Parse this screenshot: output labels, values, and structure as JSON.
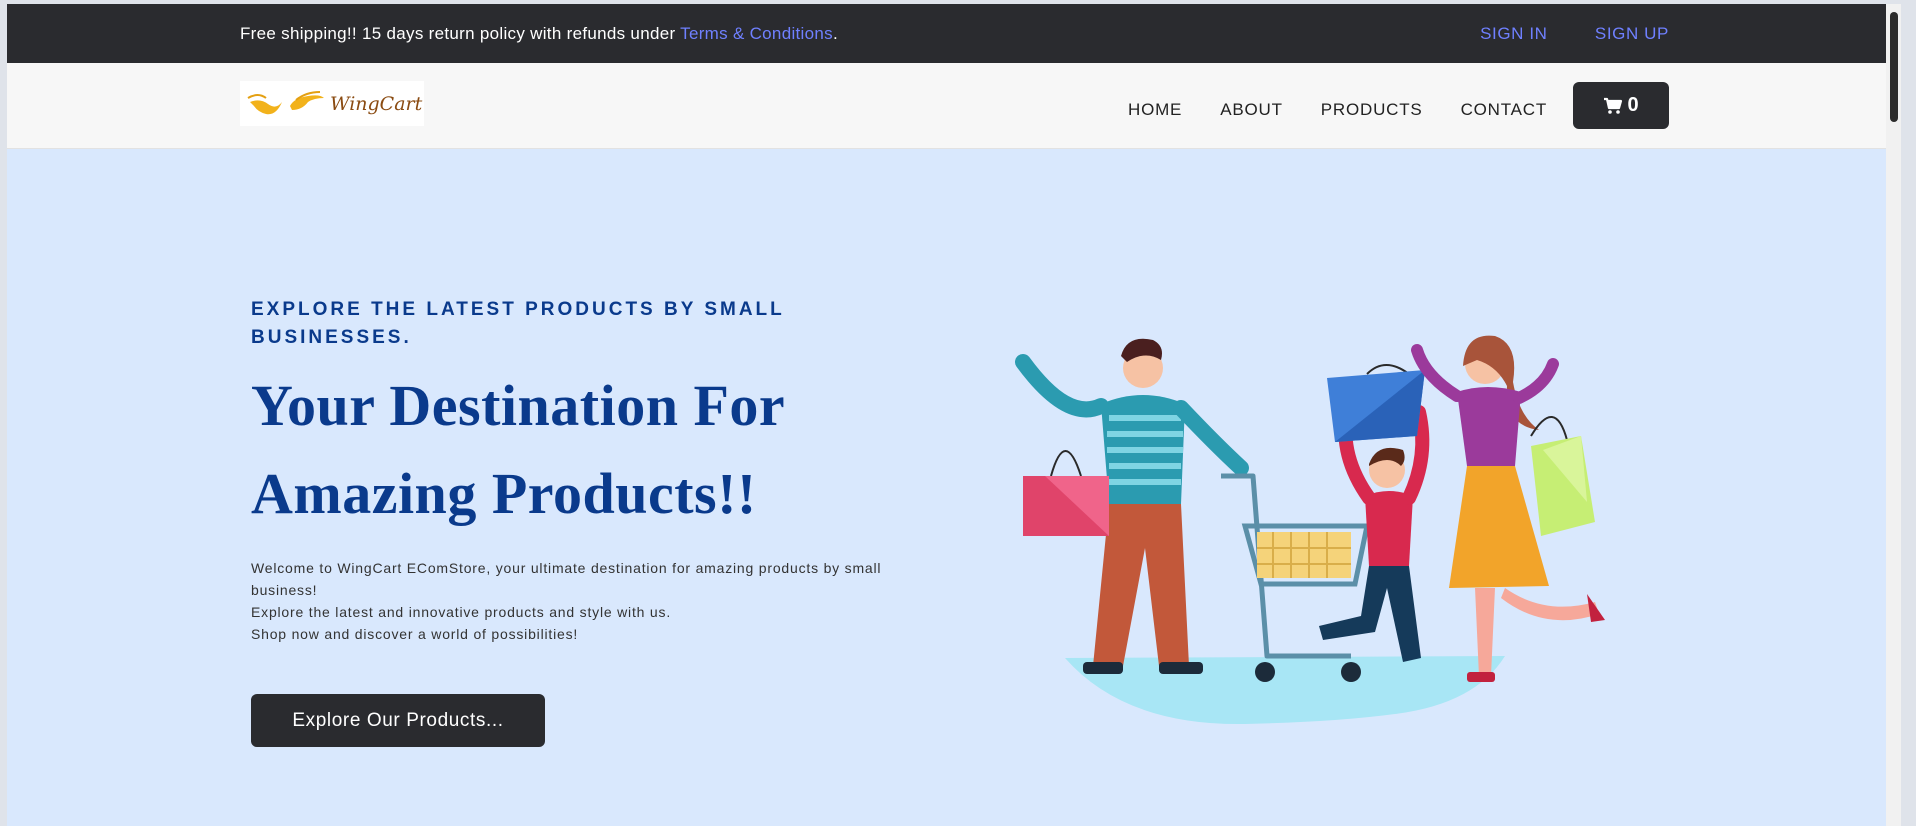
{
  "topbar": {
    "notice_prefix": "Free shipping!! 15 days return policy with refunds under ",
    "terms_link": "Terms & Conditions",
    "notice_suffix": ".",
    "sign_in": "SIGN IN",
    "sign_up": "SIGN UP"
  },
  "navbar": {
    "logo_text": "WingCart",
    "links": [
      "HOME",
      "ABOUT",
      "PRODUCTS",
      "CONTACT"
    ],
    "cart_count": "0"
  },
  "hero": {
    "eyebrow": "EXPLORE THE LATEST PRODUCTS BY SMALL BUSINESSES.",
    "headline_line1": "Your Destination For",
    "headline_line2": "Amazing Products!!",
    "desc_line1": "Welcome to WingCart EComStore, your ultimate destination for amazing products by small business!",
    "desc_line2": "Explore the latest and innovative products and style with us.",
    "desc_line3": "Shop now and discover a world of possibilities!",
    "cta": "Explore Our Products..."
  },
  "colors": {
    "dark": "#2a2b2f",
    "link": "#6f80ff",
    "hero_bg": "#d9e8fd",
    "heading": "#0a3a8c"
  }
}
